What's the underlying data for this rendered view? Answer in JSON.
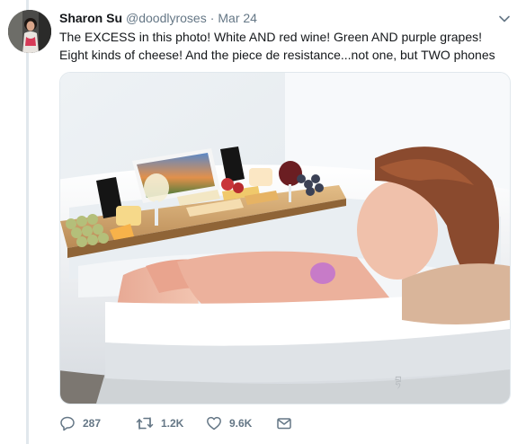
{
  "tweet": {
    "author": {
      "display_name": "Sharon Su",
      "handle": "@doodlyroses",
      "date": "Mar 24",
      "separator": "·"
    },
    "text_lines": [
      "The EXCESS in this photo! White AND red wine! Green AND purple grapes!",
      "Eight kinds of cheese! And the piece de resistance...not one, but TWO phones"
    ],
    "image": {
      "watermark": "བྷ"
    },
    "actions": {
      "reply_count": "287",
      "retweet_count": "1.2K",
      "like_count": "9.6K"
    }
  },
  "icons": {
    "caret": "chevron-down-icon",
    "reply": "reply-icon",
    "retweet": "retweet-icon",
    "like": "heart-icon",
    "message": "envelope-icon"
  },
  "colors": {
    "text_primary": "#14171a",
    "text_secondary": "#657786",
    "thread_line": "#e1e8ed"
  }
}
